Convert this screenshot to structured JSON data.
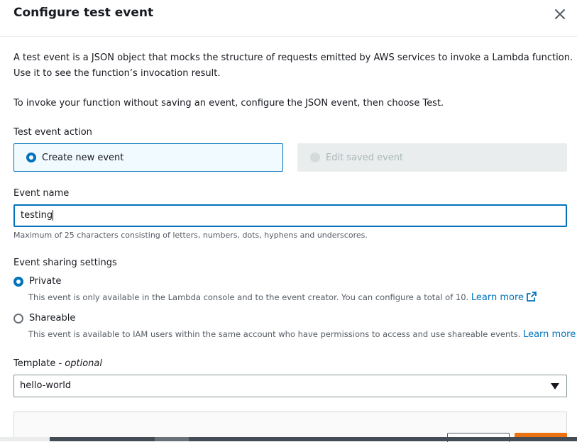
{
  "modal": {
    "title": "Configure test event",
    "close_icon": "close-icon"
  },
  "intro": {
    "line1": "A test event is a JSON object that mocks the structure of requests emitted by AWS services to invoke a Lambda function.",
    "line2": "Use it to see the function’s invocation result.",
    "line3": "To invoke your function without saving an event, configure the JSON event, then choose Test."
  },
  "test_event_action": {
    "label": "Test event action",
    "options": [
      {
        "label": "Create new event",
        "selected": true,
        "disabled": false
      },
      {
        "label": "Edit saved event",
        "selected": false,
        "disabled": true
      }
    ]
  },
  "event_name": {
    "label": "Event name",
    "value": "testing",
    "hint": "Maximum of 25 characters consisting of letters, numbers, dots, hyphens and underscores."
  },
  "sharing": {
    "label": "Event sharing settings",
    "options": [
      {
        "label": "Private",
        "selected": true,
        "description": "This event is only available in the Lambda console and to the event creator. You can configure a total of 10.",
        "link": "Learn more"
      },
      {
        "label": "Shareable",
        "selected": false,
        "description": "This event is available to IAM users within the same account who have permissions to access and use shareable events.",
        "link": "Learn more"
      }
    ]
  },
  "template": {
    "label": "Template - ",
    "label_optional": "optional",
    "value": "hello-world"
  },
  "colors": {
    "accent": "#0073bb",
    "primary_button": "#ec7211",
    "selected_tile_bg": "#f1faff",
    "disabled_tile_bg": "#eaeded"
  }
}
